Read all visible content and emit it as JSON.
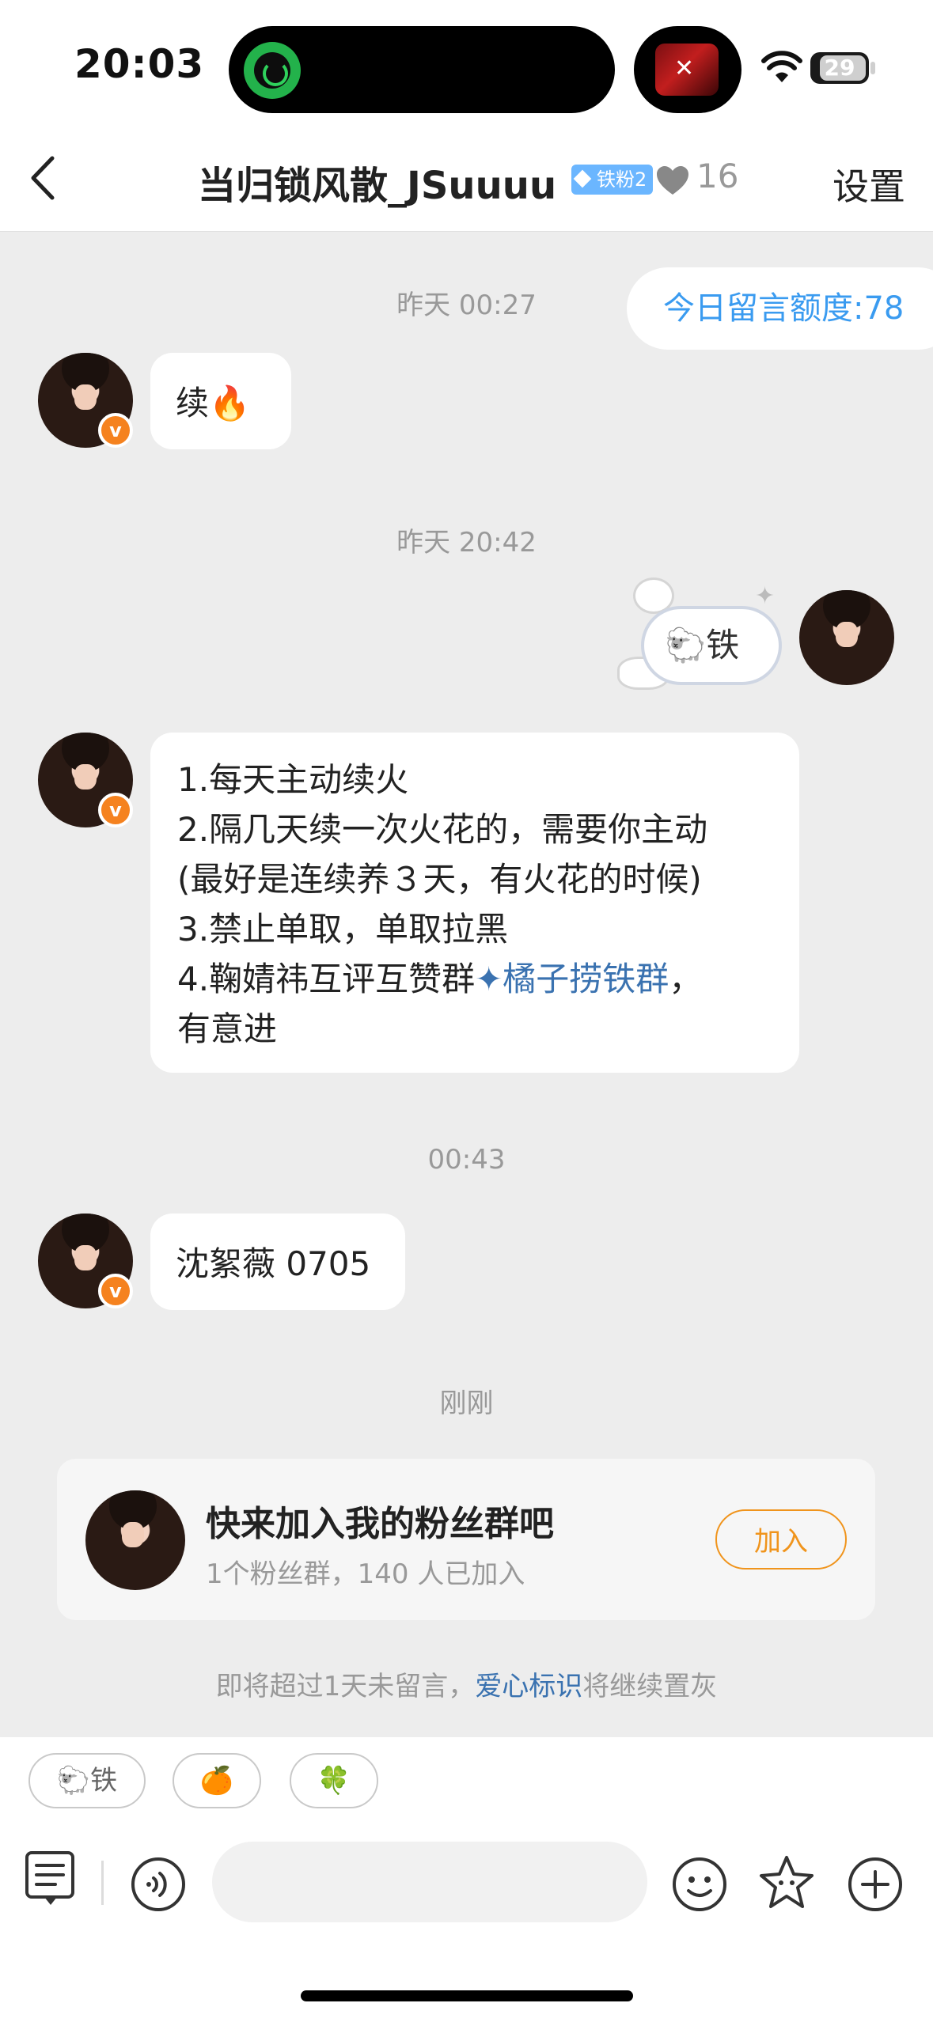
{
  "status_bar": {
    "time": "20:03",
    "battery": "29"
  },
  "header": {
    "title": "当归锁风散_JSuuuu",
    "badge": "铁粉2",
    "heart_count": "16",
    "settings": "设置"
  },
  "chat": {
    "quota": "今日留言额度:78",
    "timestamps": [
      "昨天 00:27",
      "昨天 20:42",
      "00:43",
      "刚刚"
    ],
    "messages": [
      {
        "text": "续🔥"
      },
      {
        "text": "🐑铁"
      },
      {
        "lines": [
          "1.每天主动续火",
          "2.隔几天续一次火花的，需要你主动",
          "(最好是连续养３天，有火花的时候)",
          "3.禁止单取，单取拉黑",
          "4.鞠婧祎互评互赞群"
        ],
        "link": "橘子捞铁群",
        "tail": "，",
        "last_line": "有意进"
      },
      {
        "text": "沈絮薇 0705"
      }
    ]
  },
  "fan_group_card": {
    "title": "快来加入我的粉丝群吧",
    "subtitle": "1个粉丝群，140 人已加入",
    "join_label": "加入"
  },
  "notice": {
    "prefix": "即将超过1天未留言，",
    "link": "爱心标识",
    "suffix": "将继续置灰"
  },
  "quick_replies": [
    "🐑铁",
    "🍊",
    "🍀"
  ]
}
